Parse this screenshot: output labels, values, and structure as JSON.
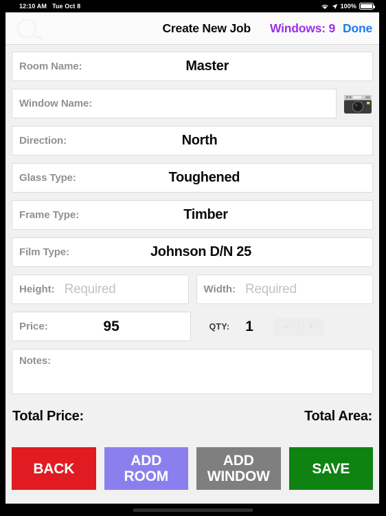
{
  "status_bar": {
    "time": "12:10 AM",
    "date": "Tue Oct 8",
    "battery_percent": "100%",
    "wifi_icon": "wifi-icon",
    "location_icon": "location-arrow-icon",
    "battery_icon": "battery-full-icon"
  },
  "navbar": {
    "title": "Create New Job",
    "windows_label": "Windows: 9",
    "done_label": "Done",
    "windows_color": "#9B30E8",
    "done_color": "#1a7bf5"
  },
  "form": {
    "room_name": {
      "label": "Room Name:",
      "value": "Master"
    },
    "window_name": {
      "label": "Window Name:",
      "value": ""
    },
    "camera_button": {
      "icon": "camera-icon"
    },
    "direction": {
      "label": "Direction:",
      "value": "North"
    },
    "glass_type": {
      "label": "Glass Type:",
      "value": "Toughened"
    },
    "frame_type": {
      "label": "Frame Type:",
      "value": "Timber"
    },
    "film_type": {
      "label": "Film Type:",
      "value": "Johnson D/N 25"
    },
    "height": {
      "label": "Height:",
      "value": "",
      "placeholder": "Required"
    },
    "width": {
      "label": "Width:",
      "value": "",
      "placeholder": "Required"
    },
    "price": {
      "label": "Price:",
      "value": "95"
    },
    "qty": {
      "label": "QTY:",
      "value": "1",
      "decrement_label": "–",
      "increment_label": "+"
    },
    "notes": {
      "label": "Notes:",
      "value": ""
    }
  },
  "totals": {
    "total_price_label": "Total Price:",
    "total_price_value": "",
    "total_area_label": "Total Area:",
    "total_area_value": ""
  },
  "buttons": [
    {
      "name": "back-button",
      "line1": "BACK",
      "line2": "",
      "color": "#e01b22"
    },
    {
      "name": "add-room-button",
      "line1": "ADD",
      "line2": "ROOM",
      "color": "#8b7fee"
    },
    {
      "name": "add-window-button",
      "line1": "ADD",
      "line2": "WINDOW",
      "color": "#7f7f7f"
    },
    {
      "name": "save-button",
      "line1": "SAVE",
      "line2": "",
      "color": "#0f8212"
    }
  ]
}
